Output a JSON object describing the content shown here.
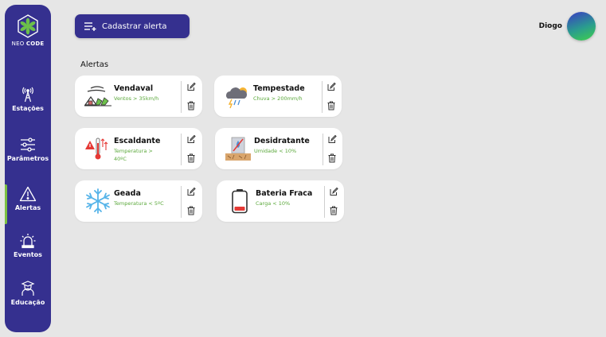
{
  "sidebar": {
    "logo": {
      "part1": "NEO",
      "part2": "CODE"
    },
    "items": [
      {
        "label": "Estações"
      },
      {
        "label": "Parâmetros"
      },
      {
        "label": "Alertas"
      },
      {
        "label": "Eventos"
      },
      {
        "label": "Educação"
      }
    ]
  },
  "header": {
    "cta_label": "Cadastrar alerta",
    "user_name": "Diogo"
  },
  "main": {
    "section_title": "Alertas",
    "alerts": [
      {
        "title": "Vendaval",
        "subtitle": "Ventos > 35km/h",
        "icon": "windstorm-icon"
      },
      {
        "title": "Tempestade",
        "subtitle": "Chuva > 200mm/h",
        "icon": "storm-icon"
      },
      {
        "title": "Escaldante",
        "subtitle": "Temperatura > 40ºC",
        "icon": "hot-thermometer-icon"
      },
      {
        "title": "Desidratante",
        "subtitle": "Umidade < 10%",
        "icon": "dry-humidity-icon"
      },
      {
        "title": "Geada",
        "subtitle": "Temperatura < 5ºC",
        "icon": "snowflake-icon"
      },
      {
        "title": "Bateria Fraca",
        "subtitle": "Carga < 10%",
        "icon": "low-battery-icon"
      }
    ]
  },
  "colors": {
    "primary": "#35308f",
    "accent": "#5aa83a",
    "background": "#e6e6e6"
  }
}
